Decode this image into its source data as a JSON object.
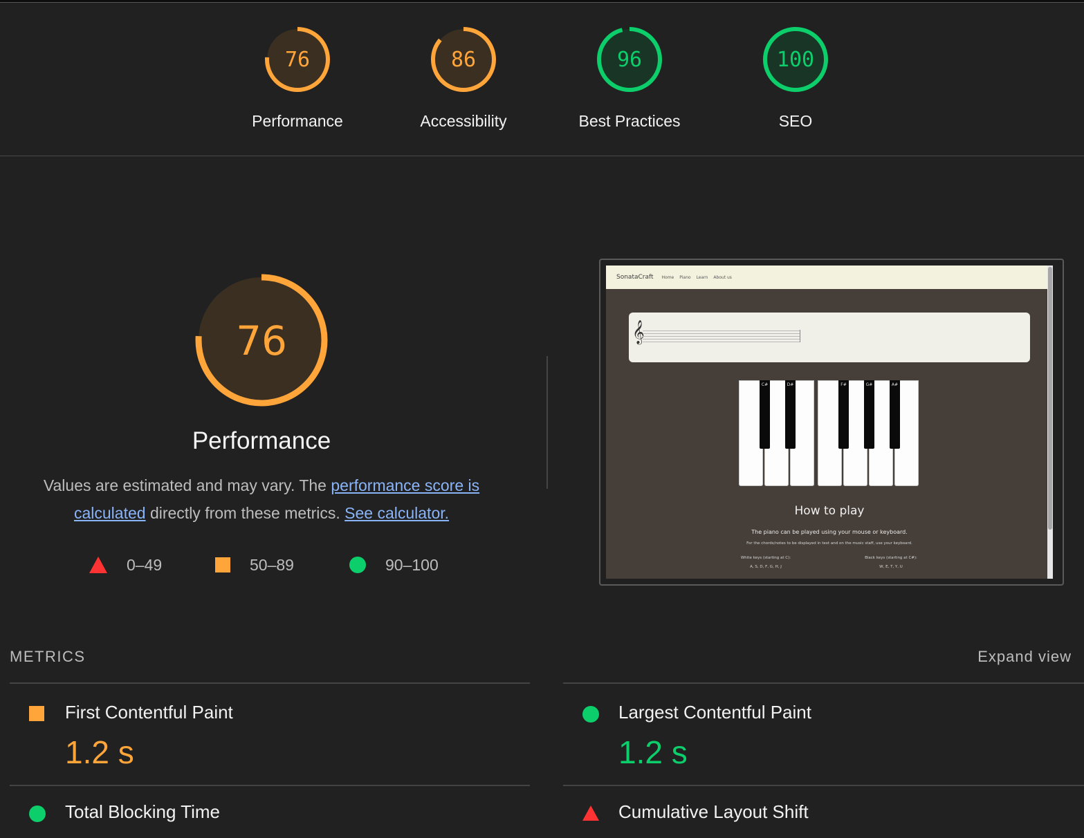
{
  "colors": {
    "average": "#ffa53a",
    "pass": "#0cce6b",
    "fail": "#ff3333",
    "average_bg": "#3a2f21",
    "pass_bg": "#183525",
    "link": "#8ab4f8"
  },
  "categories": [
    {
      "label": "Performance",
      "score": 76,
      "rating": "average"
    },
    {
      "label": "Accessibility",
      "score": 86,
      "rating": "average"
    },
    {
      "label": "Best Practices",
      "score": 96,
      "rating": "pass"
    },
    {
      "label": "SEO",
      "score": 100,
      "rating": "pass"
    }
  ],
  "performance": {
    "score": 76,
    "title": "Performance",
    "desc_prefix": "Values are estimated and may vary. The ",
    "desc_link1": "performance score is calculated",
    "desc_middle": " directly from these metrics. ",
    "desc_link2": "See calculator."
  },
  "legend": [
    {
      "shape": "triangle-icon",
      "range": "0–49"
    },
    {
      "shape": "square-icon",
      "range": "50–89"
    },
    {
      "shape": "circle-icon",
      "range": "90–100"
    }
  ],
  "screenshot": {
    "brand": "SonataCraft",
    "nav": [
      "Home",
      "Piano",
      "Learn",
      "About us"
    ],
    "black_keys": [
      "C#",
      "D#",
      "F#",
      "G#",
      "A#"
    ],
    "how_to_play": "How to play",
    "line1": "The piano can be played using your mouse or keyboard.",
    "line2": "For the chords/notes to be displayed in text and on the music staff, use your keyboard.",
    "white_keys_label": "White keys (starting at C):",
    "white_keys_value": "A, S, D, F, G, H, J",
    "black_keys_label": "Black keys (starting at C#):",
    "black_keys_value": "W, E, T, Y, U"
  },
  "metrics": {
    "heading": "METRICS",
    "expand_label": "Expand view",
    "items": [
      {
        "title": "First Contentful Paint",
        "value": "1.2 s",
        "rating": "average",
        "icon": "square-icon"
      },
      {
        "title": "Largest Contentful Paint",
        "value": "1.2 s",
        "rating": "pass",
        "icon": "circle-icon"
      },
      {
        "title": "Total Blocking Time",
        "value": "",
        "rating": "pass",
        "icon": "circle-icon"
      },
      {
        "title": "Cumulative Layout Shift",
        "value": "",
        "rating": "fail",
        "icon": "triangle-icon"
      }
    ]
  }
}
